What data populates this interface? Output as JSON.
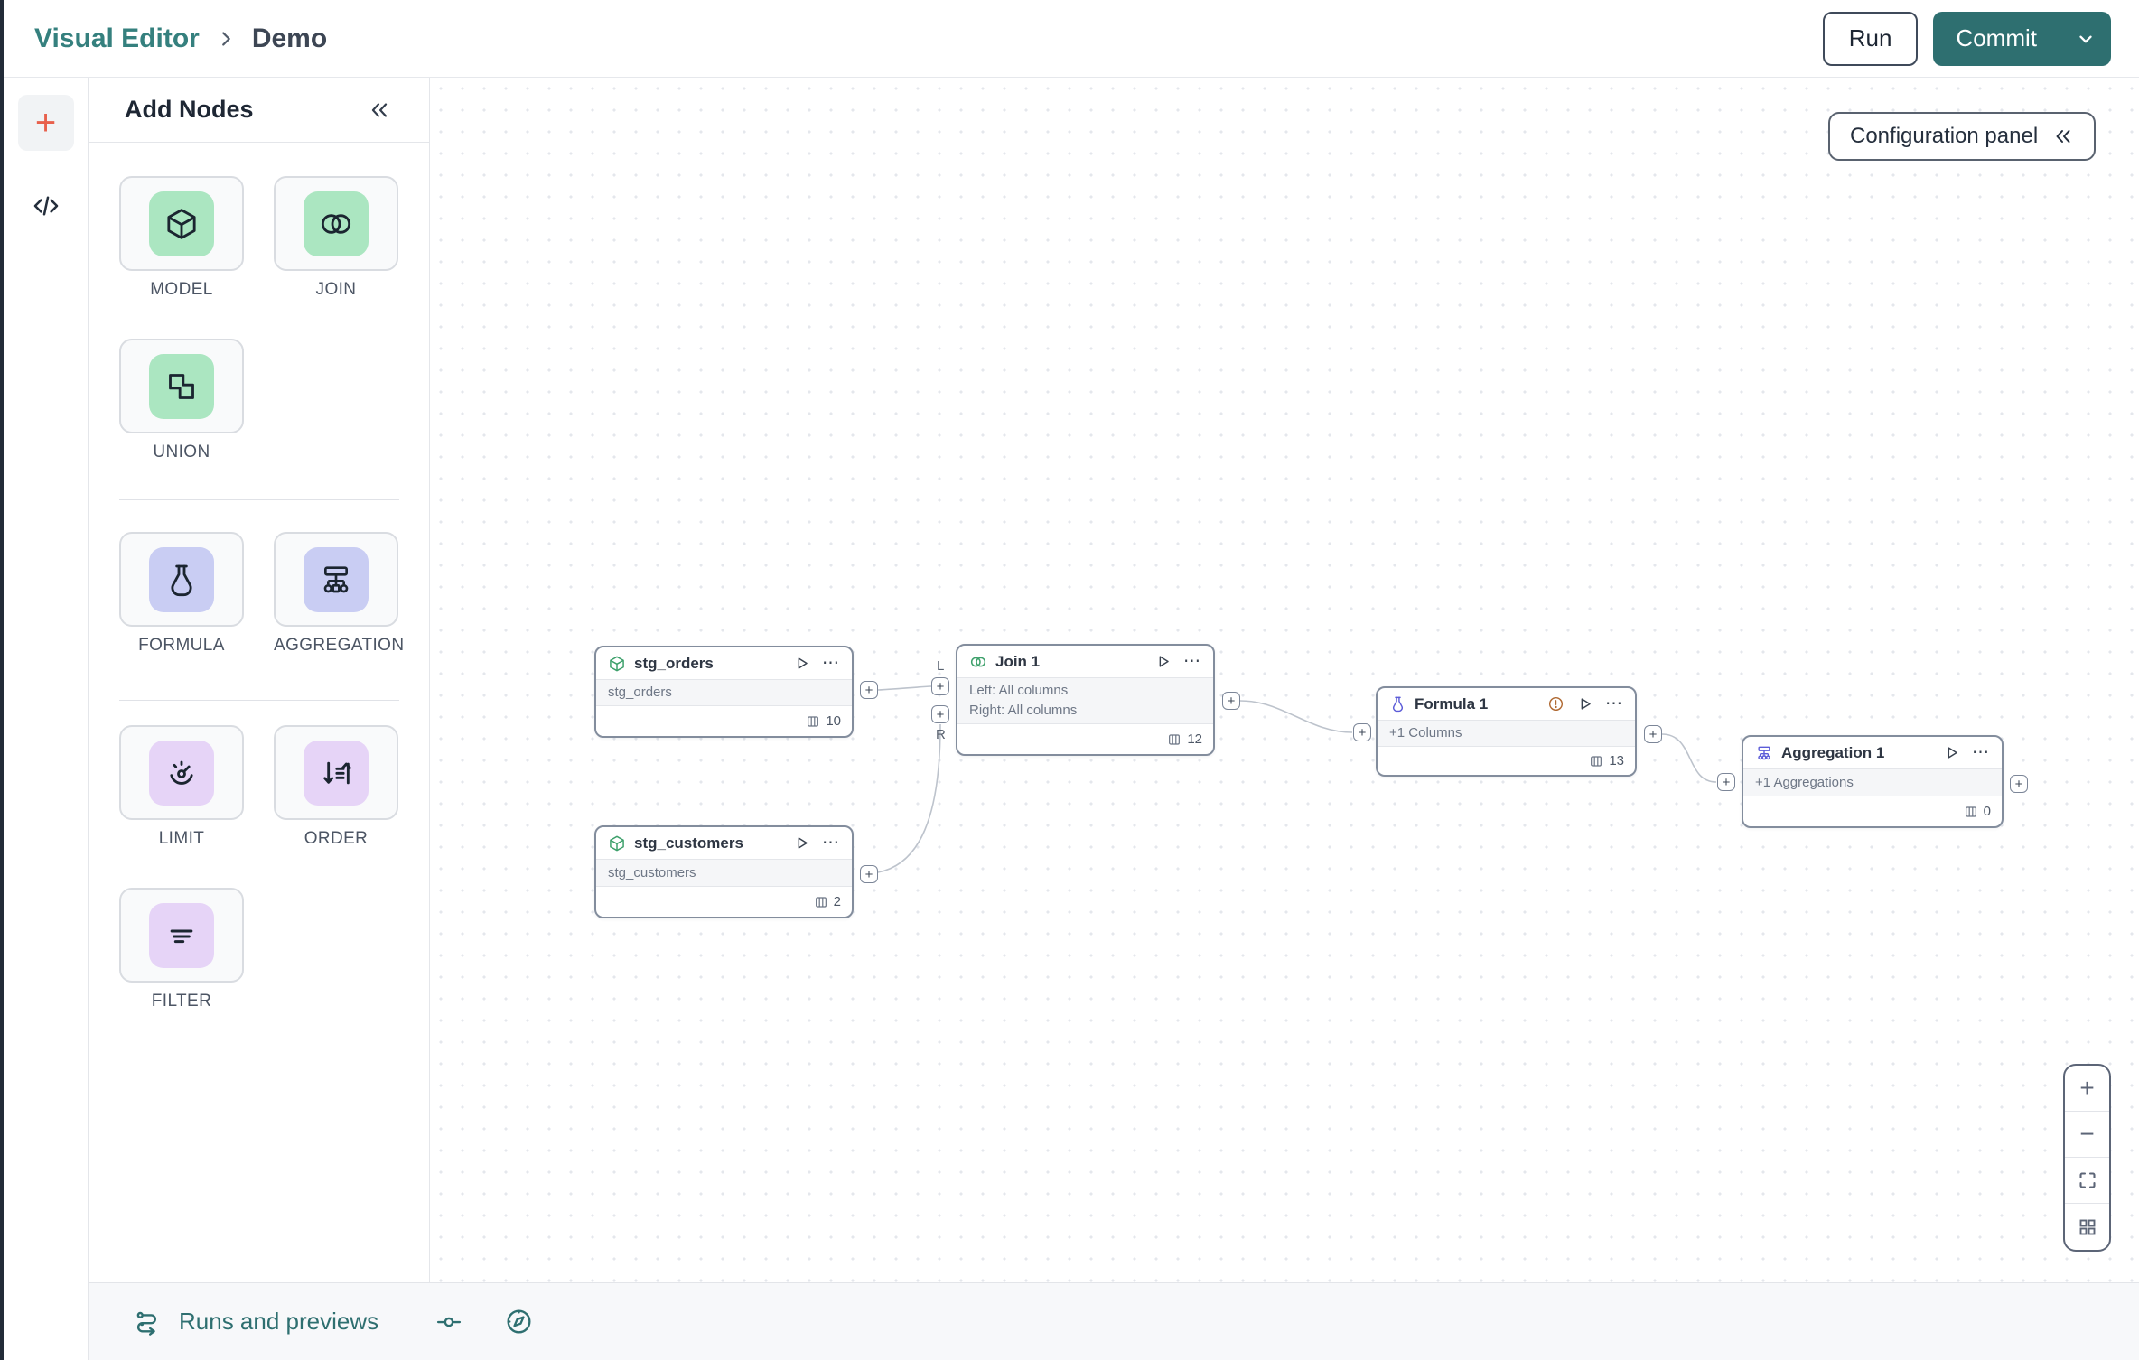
{
  "header": {
    "breadcrumb": {
      "section": "Visual Editor",
      "page": "Demo"
    },
    "run_label": "Run",
    "commit_label": "Commit"
  },
  "panel": {
    "title": "Add Nodes",
    "groups": [
      {
        "items": [
          {
            "label": "MODEL",
            "icon": "cube-icon",
            "tint": "green"
          },
          {
            "label": "JOIN",
            "icon": "join-circles-icon",
            "tint": "green"
          },
          {
            "label": "UNION",
            "icon": "union-shapes-icon",
            "tint": "green"
          }
        ]
      },
      {
        "items": [
          {
            "label": "FORMULA",
            "icon": "flask-icon",
            "tint": "indigo"
          },
          {
            "label": "AGGREGATION",
            "icon": "hierarchy-icon",
            "tint": "indigo"
          }
        ]
      },
      {
        "items": [
          {
            "label": "LIMIT",
            "icon": "gauge-icon",
            "tint": "purple"
          },
          {
            "label": "ORDER",
            "icon": "sort-arrows-icon",
            "tint": "purple"
          },
          {
            "label": "FILTER",
            "icon": "filter-lines-icon",
            "tint": "purple"
          }
        ]
      }
    ]
  },
  "canvas": {
    "config_panel_label": "Configuration panel",
    "nodes": [
      {
        "title": "stg_orders",
        "icon": "cube-icon",
        "body": [
          "stg_orders"
        ],
        "columns": "10"
      },
      {
        "title": "stg_customers",
        "icon": "cube-icon",
        "body": [
          "stg_customers"
        ],
        "columns": "2"
      },
      {
        "title": "Join 1",
        "icon": "join-circles-icon",
        "body": [
          "Left: All columns",
          "Right: All columns"
        ],
        "columns": "12"
      },
      {
        "title": "Formula 1",
        "icon": "flask-icon",
        "body": [
          "+1 Columns"
        ],
        "columns": "13",
        "warning": true
      },
      {
        "title": "Aggregation 1",
        "icon": "hierarchy-icon",
        "body": [
          "+1 Aggregations"
        ],
        "columns": "0"
      }
    ],
    "join_port_labels": {
      "left": "L",
      "right": "R"
    }
  },
  "bottom_bar": {
    "runs_label": "Runs and previews"
  },
  "icons": {
    "plus": "+",
    "minus": "−",
    "ellipsis": "⋯",
    "port_plus": "+"
  },
  "colors": {
    "brand_teal": "#2e6f70",
    "accent_orange": "#e8604c",
    "tile_green": "#abe6c1",
    "tile_indigo": "#c9cdf3",
    "tile_purple": "#e6d4f7",
    "node_icon_green": "#3da06b",
    "node_icon_indigo": "#5c5cd8",
    "warning": "#b06a33"
  }
}
